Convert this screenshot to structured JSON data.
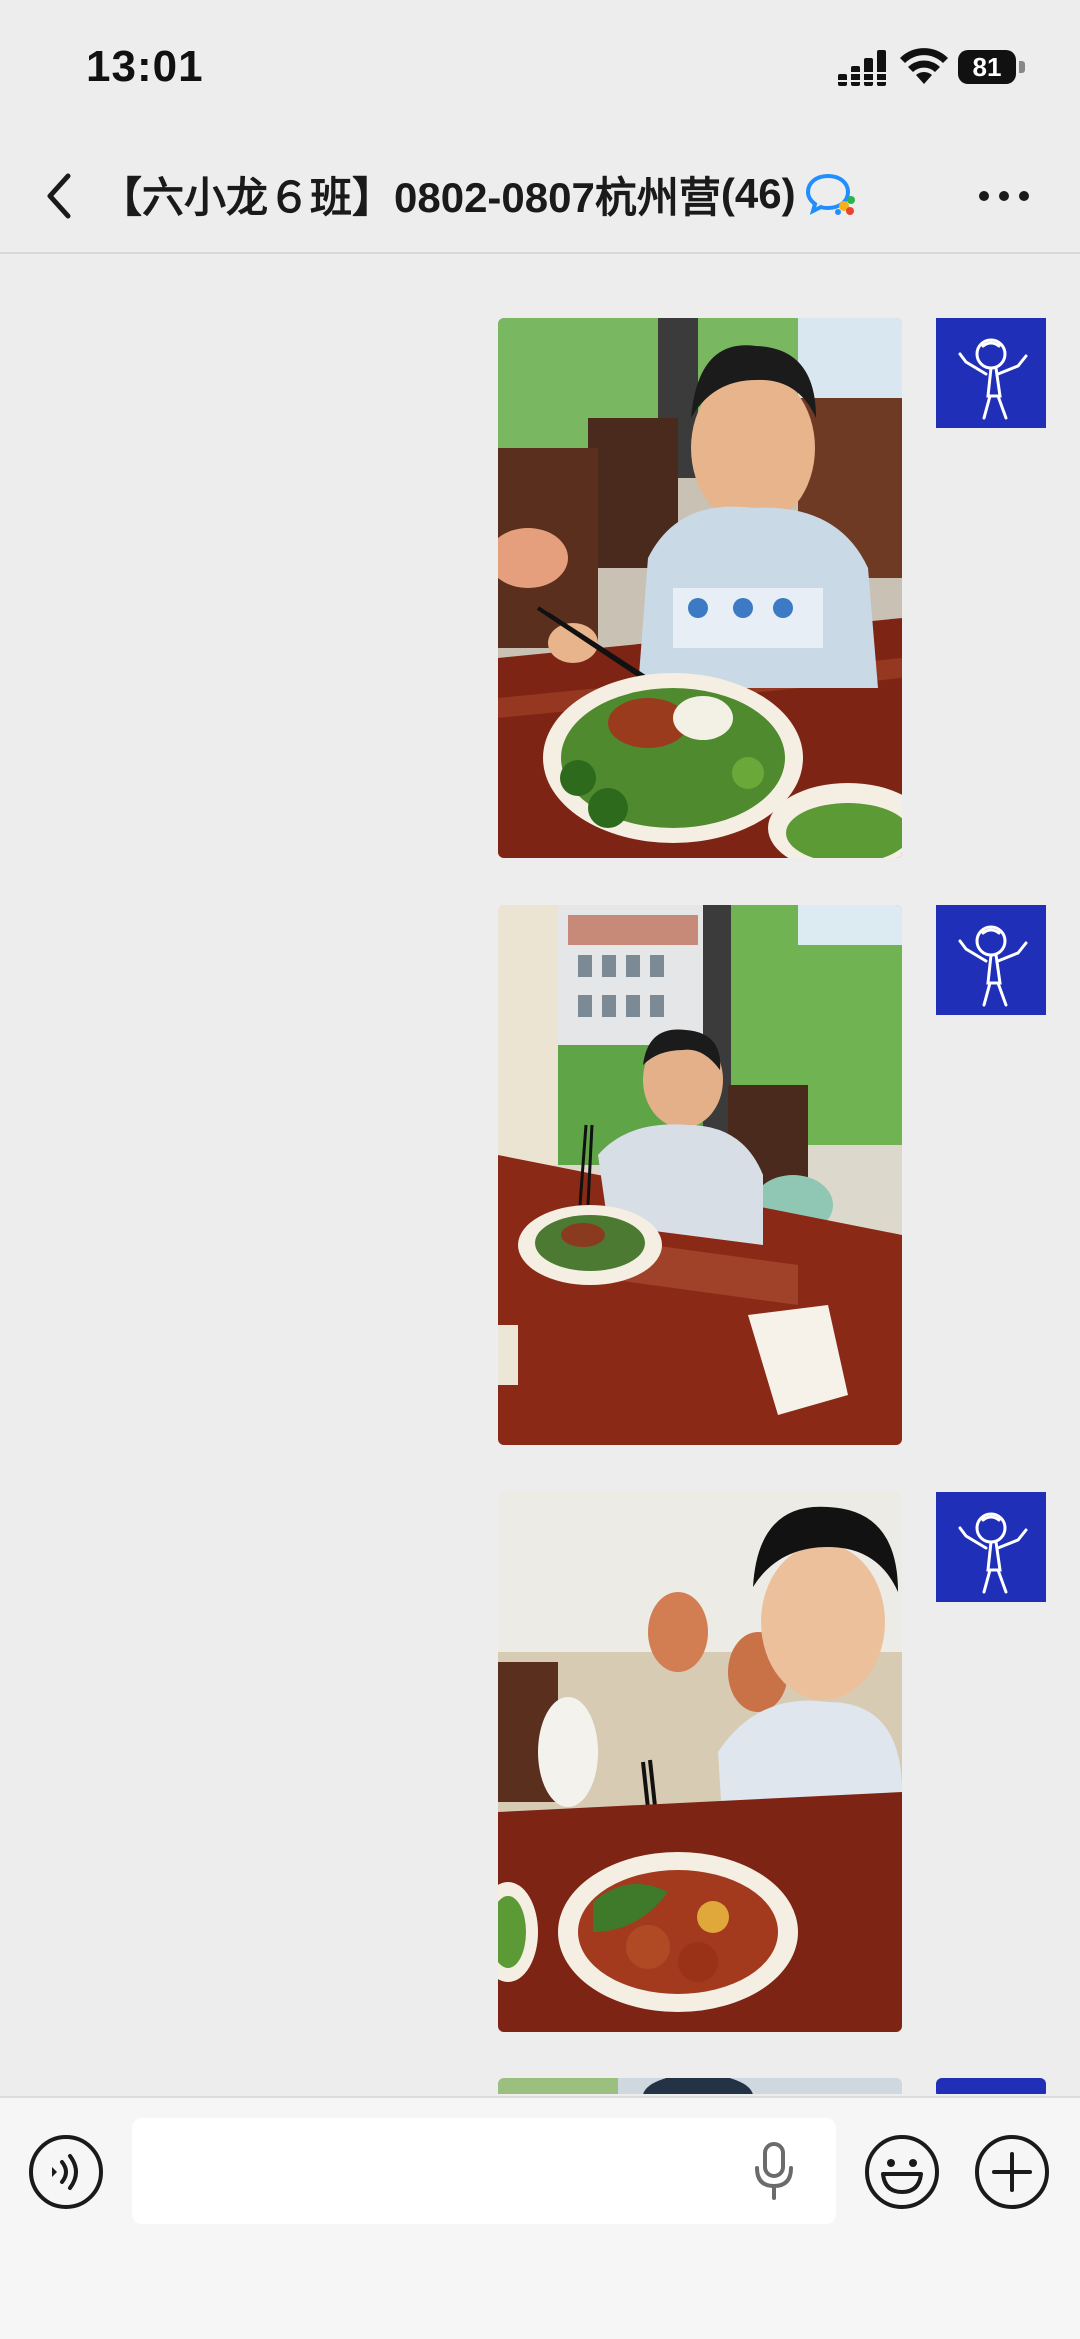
{
  "status_bar": {
    "time": "13:01",
    "battery_level": "81"
  },
  "header": {
    "title": "【六小龙６班】0802-0807杭州营",
    "member_count": "(46)"
  },
  "messages": [
    {
      "type": "image",
      "description_icon": "photo-boy-eating-vegetables",
      "sender_avatar": "stick-figure-avatar"
    },
    {
      "type": "image",
      "description_icon": "photo-boy-window-table",
      "sender_avatar": "stick-figure-avatar"
    },
    {
      "type": "image",
      "description_icon": "photo-boy-chicken-plate",
      "sender_avatar": "stick-figure-avatar"
    }
  ],
  "input": {
    "placeholder": "",
    "value": ""
  },
  "colors": {
    "avatar_bg": "#1f2fb8",
    "background": "#ededed",
    "accent": "#1f8fff"
  }
}
